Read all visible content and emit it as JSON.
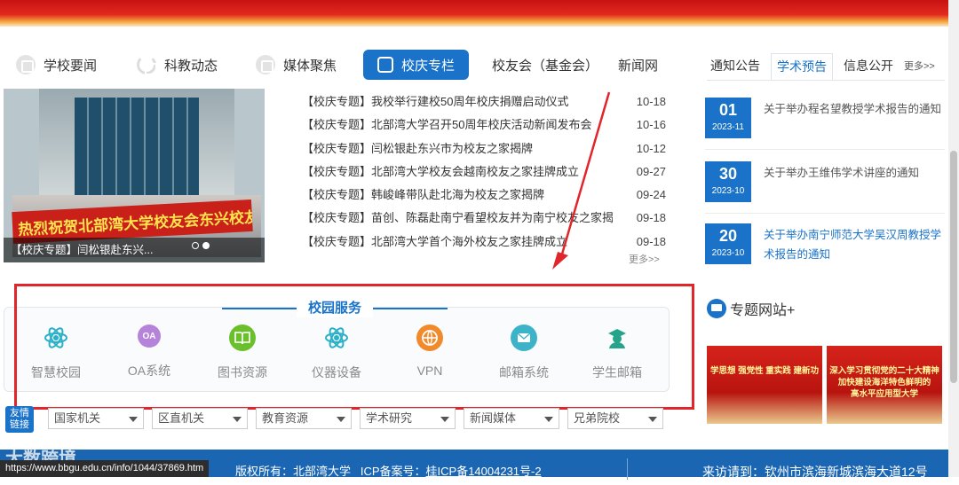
{
  "tabs": [
    {
      "label": "学校要闻",
      "icon": "news-icon"
    },
    {
      "label": "科教动态",
      "icon": "spinner-icon"
    },
    {
      "label": "媒体聚焦",
      "icon": "media-icon"
    },
    {
      "label": "校庆专栏",
      "icon": "book-icon",
      "active": true
    },
    {
      "label": "校友会（基金会）"
    },
    {
      "label": "新闻网"
    }
  ],
  "carousel": {
    "banner_text": "热烈祝贺北部湾大学校友会东兴校友之家成立!",
    "caption": "【校庆专题】闫松银赴东兴..."
  },
  "news": [
    {
      "title": "【校庆专题】我校举行建校50周年校庆捐赠启动仪式",
      "date": "10-18"
    },
    {
      "title": "【校庆专题】北部湾大学召开50周年校庆活动新闻发布会",
      "date": "10-16"
    },
    {
      "title": "【校庆专题】闫松银赴东兴市为校友之家揭牌",
      "date": "10-12"
    },
    {
      "title": "【校庆专题】北部湾大学校友会越南校友之家挂牌成立",
      "date": "09-27"
    },
    {
      "title": "【校庆专题】韩峻峰带队赴北海为校友之家揭牌",
      "date": "09-24"
    },
    {
      "title": "【校庆专题】苗创、陈磊赴南宁看望校友并为南宁校友之家揭牌",
      "date": "09-18"
    },
    {
      "title": "【校庆专题】北部湾大学首个海外校友之家挂牌成立",
      "date": "09-18"
    }
  ],
  "news_more": "更多>>",
  "services": {
    "title": "校园服务",
    "items": [
      {
        "label": "智慧校园",
        "icon": "atom-icon",
        "color": "#2ab0c8"
      },
      {
        "label": "OA系统",
        "icon": "oa-icon",
        "glyph": "OA",
        "color": "#b583d9"
      },
      {
        "label": "图书资源",
        "icon": "book-icon",
        "color": "#6cbf2c"
      },
      {
        "label": "仪器设备",
        "icon": "atom-icon",
        "color": "#2ab0c8"
      },
      {
        "label": "VPN",
        "icon": "vpn-icon",
        "color": "#f08a2a"
      },
      {
        "label": "邮箱系统",
        "icon": "mail-icon",
        "color": "#3cb3c9"
      },
      {
        "label": "学生邮箱",
        "icon": "graduate-icon",
        "color": "#25a38b"
      }
    ]
  },
  "links": {
    "friend": "友情链接",
    "selects": [
      "国家机关",
      "区直机关",
      "教育资源",
      "学术研究",
      "新闻媒体",
      "兄弟院校"
    ]
  },
  "right": {
    "tabs": [
      "通知公告",
      "学术预告",
      "信息公开"
    ],
    "active_tab": 1,
    "more": "更多>>",
    "notices": [
      {
        "day": "01",
        "ym": "2023-11",
        "text": "关于举办程名望教授学术报告的通知"
      },
      {
        "day": "30",
        "ym": "2023-10",
        "text": "关于举办王维伟学术讲座的通知"
      },
      {
        "day": "20",
        "ym": "2023-10",
        "text": "关于举办南宁师范大学吴汉周教授学术报告的通知"
      }
    ],
    "topic_title": "专题网站+",
    "posters": [
      {
        "line1": "学思想 强党性 重实践 建新功"
      },
      {
        "line1": "深入学习贯彻党的二十大精神",
        "line2": "加快建设海洋特色鲜明的",
        "line3": "高水平应用型大学"
      }
    ]
  },
  "footer": {
    "watermark": "大数跨境",
    "status_url": "https://www.bbgu.edu.cn/info/1044/37869.htm",
    "copyright_label": "版权所有：北部湾大学",
    "icp_label": "ICP备案号：",
    "icp": "桂ICP备14004231号-2",
    "address": "来访请到：钦州市滨海新城滨海大道12号"
  }
}
